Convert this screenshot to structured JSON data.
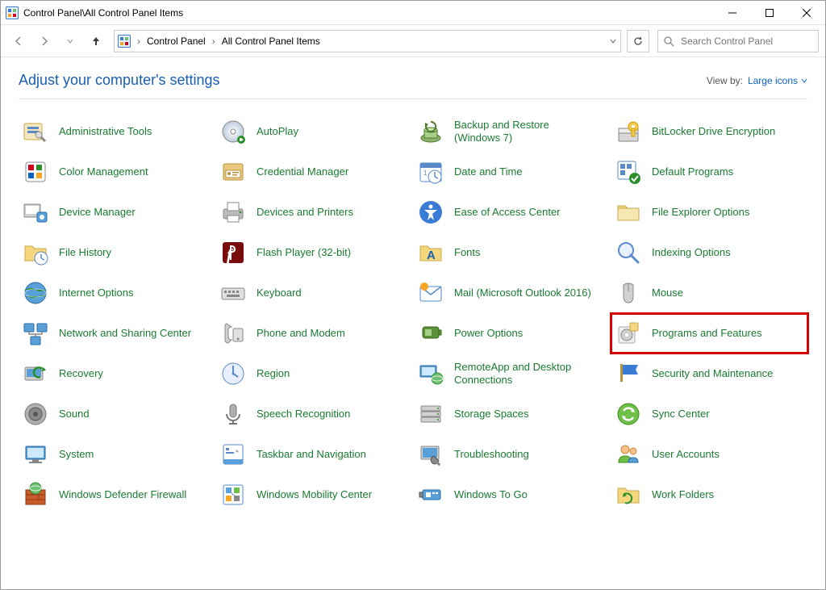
{
  "titlebar": {
    "title": "Control Panel\\All Control Panel Items"
  },
  "breadcrumb": {
    "root": "Control Panel",
    "current": "All Control Panel Items"
  },
  "search": {
    "placeholder": "Search Control Panel"
  },
  "settings": {
    "heading": "Adjust your computer's settings",
    "viewby_label": "View by:",
    "viewby_value": "Large icons"
  },
  "items": [
    {
      "label": "Administrative Tools",
      "icon": "tools"
    },
    {
      "label": "AutoPlay",
      "icon": "autoplay"
    },
    {
      "label": "Backup and Restore (Windows 7)",
      "icon": "backup"
    },
    {
      "label": "BitLocker Drive Encryption",
      "icon": "bitlocker"
    },
    {
      "label": "Color Management",
      "icon": "color"
    },
    {
      "label": "Credential Manager",
      "icon": "credential"
    },
    {
      "label": "Date and Time",
      "icon": "datetime"
    },
    {
      "label": "Default Programs",
      "icon": "defaultprog"
    },
    {
      "label": "Device Manager",
      "icon": "devicemgr"
    },
    {
      "label": "Devices and Printers",
      "icon": "devprint"
    },
    {
      "label": "Ease of Access Center",
      "icon": "ease"
    },
    {
      "label": "File Explorer Options",
      "icon": "folderopt"
    },
    {
      "label": "File History",
      "icon": "filehistory"
    },
    {
      "label": "Flash Player (32-bit)",
      "icon": "flash"
    },
    {
      "label": "Fonts",
      "icon": "fonts"
    },
    {
      "label": "Indexing Options",
      "icon": "indexing"
    },
    {
      "label": "Internet Options",
      "icon": "internet"
    },
    {
      "label": "Keyboard",
      "icon": "keyboard"
    },
    {
      "label": "Mail (Microsoft Outlook 2016)",
      "icon": "mail"
    },
    {
      "label": "Mouse",
      "icon": "mouse"
    },
    {
      "label": "Network and Sharing Center",
      "icon": "network"
    },
    {
      "label": "Phone and Modem",
      "icon": "phone"
    },
    {
      "label": "Power Options",
      "icon": "power"
    },
    {
      "label": "Programs and Features",
      "icon": "programs",
      "highlighted": true
    },
    {
      "label": "Recovery",
      "icon": "recovery"
    },
    {
      "label": "Region",
      "icon": "region"
    },
    {
      "label": "RemoteApp and Desktop Connections",
      "icon": "remote"
    },
    {
      "label": "Security and Maintenance",
      "icon": "security"
    },
    {
      "label": "Sound",
      "icon": "sound"
    },
    {
      "label": "Speech Recognition",
      "icon": "speech"
    },
    {
      "label": "Storage Spaces",
      "icon": "storage"
    },
    {
      "label": "Sync Center",
      "icon": "sync"
    },
    {
      "label": "System",
      "icon": "system"
    },
    {
      "label": "Taskbar and Navigation",
      "icon": "taskbar"
    },
    {
      "label": "Troubleshooting",
      "icon": "troubleshoot"
    },
    {
      "label": "User Accounts",
      "icon": "users"
    },
    {
      "label": "Windows Defender Firewall",
      "icon": "firewall"
    },
    {
      "label": "Windows Mobility Center",
      "icon": "mobility"
    },
    {
      "label": "Windows To Go",
      "icon": "wintogo"
    },
    {
      "label": "Work Folders",
      "icon": "workfolders"
    }
  ]
}
